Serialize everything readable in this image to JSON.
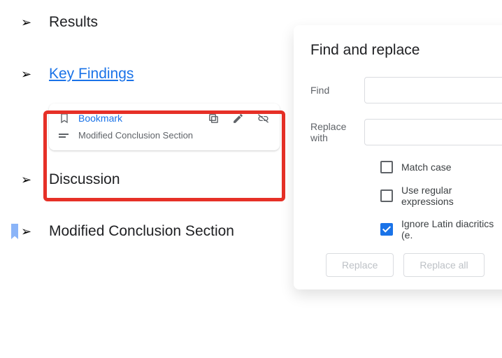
{
  "outline": {
    "items": [
      {
        "text": "Results"
      },
      {
        "text": "Key Findings",
        "link": true
      },
      {
        "text": "Discussion"
      },
      {
        "text": "Modified Conclusion Section",
        "bookmarked": true
      }
    ]
  },
  "bookmark_card": {
    "title": "Bookmark",
    "subtitle": "Modified Conclusion Section"
  },
  "find_replace": {
    "title": "Find and replace",
    "find_label": "Find",
    "replace_label": "Replace with",
    "find_value": "",
    "replace_value": "",
    "opt_match_case": "Match case",
    "opt_regex": "Use regular expressions",
    "opt_diacritics": "Ignore Latin diacritics (e.",
    "btn_replace": "Replace",
    "btn_replace_all": "Replace all"
  }
}
